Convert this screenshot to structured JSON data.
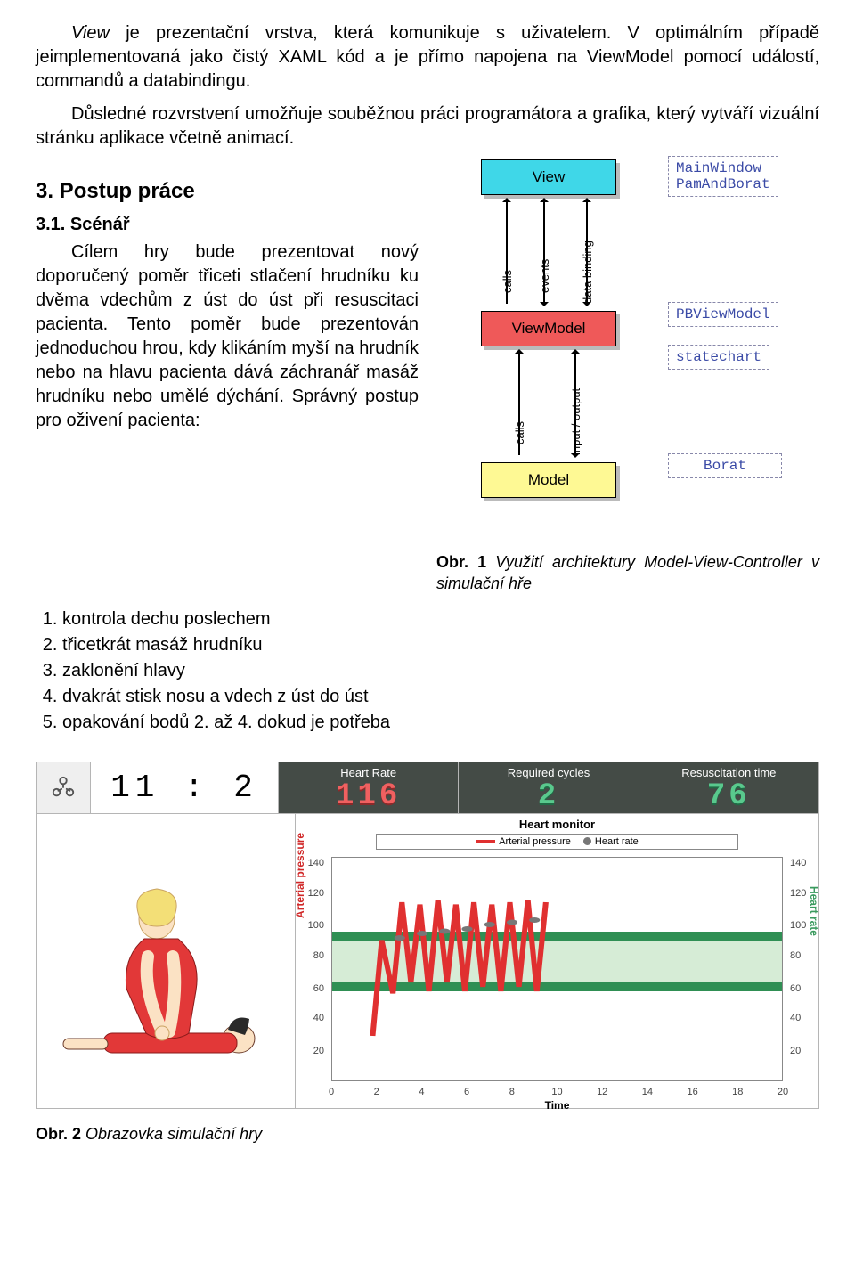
{
  "para1_a": "View",
  "para1_b": " je prezentační vrstva, která komunikuje s uživatelem. V optimálním případě jeimplementovaná jako čistý XAML kód a je přímo napojena na ViewModel pomocí událostí, commandů a databindingu.",
  "para2": "Důsledné rozvrstvení umožňuje souběžnou práci programátora a grafika, který vytváří vizuální stránku aplikace včetně animací.",
  "h_postup": "3. Postup práce",
  "h_scenar": "3.1. Scénář",
  "scenar_p1": "Cílem hry bude prezentovat nový doporučený poměr třiceti stlačení hrudníku ku dvěma vdechům z úst do úst při resuscitaci pacienta. Tento poměr bude prezentován jednoduchou hrou, kdy klikáním myší na hrudník nebo na hlavu pacienta dává záchranář masáž hrudníku nebo umělé dýchání. Správný postup pro oživení pacienta:",
  "steps": [
    "kontrola dechu poslechem",
    "třicetkrát masáž hrudníku",
    "zaklonění hlavy",
    "dvakrát stisk nosu a vdech z úst do úst",
    "opakování bodů 2. až 4. dokud je potřeba"
  ],
  "mvc": {
    "view": "View",
    "vm": "ViewModel",
    "model": "Model",
    "ann_mw": "MainWindow\nPamAndBorat",
    "ann_pbvm": "PBViewModel",
    "ann_sc": "statechart",
    "ann_borat": "Borat",
    "lbl_calls": "calls",
    "lbl_events": "events",
    "lbl_databind": "data binding",
    "lbl_io": "input / output"
  },
  "fig1_b": "Obr. 1",
  "fig1_txt": " Využití architektury Model-View-Controller v simulační hře",
  "sim": {
    "ratio": "11 : 2",
    "metrics": [
      {
        "label": "Heart Rate",
        "value": "116",
        "cls": "red"
      },
      {
        "label": "Required cycles",
        "value": "2",
        "cls": "green"
      },
      {
        "label": "Resuscitation time",
        "value": "76",
        "cls": "green"
      }
    ],
    "chart_title": "Heart monitor",
    "legend_ap": "Arterial pressure",
    "legend_hr": "Heart rate",
    "ax_l": "Arterial pressure",
    "ax_r": "Heart rate",
    "ax_x": "Time"
  },
  "fig2_b": "Obr. 2",
  "fig2_txt": " Obrazovka simulační hry",
  "chart_data": {
    "type": "line",
    "title": "Heart monitor",
    "xlabel": "Time",
    "y_left_label": "Arterial pressure",
    "y_right_label": "Heart rate",
    "x_ticks": [
      0,
      2,
      4,
      6,
      8,
      10,
      12,
      14,
      16,
      18,
      20
    ],
    "y_ticks": [
      20,
      40,
      60,
      80,
      100,
      120,
      140
    ],
    "xlim": [
      0,
      20
    ],
    "ylim": [
      0,
      150
    ],
    "bands": [
      {
        "axis": "y",
        "from": 60,
        "to": 100,
        "color": "light-green"
      },
      {
        "axis": "y",
        "from": 60,
        "to": 66,
        "color": "dark-green"
      },
      {
        "axis": "y",
        "from": 94,
        "to": 100,
        "color": "dark-green"
      }
    ],
    "series": [
      {
        "name": "Arterial pressure",
        "color": "#e03030",
        "x": [
          1.8,
          2.2,
          2.7,
          3.1,
          3.5,
          3.9,
          4.3,
          4.7,
          5.1,
          5.5,
          5.9,
          6.3,
          6.7,
          7.1,
          7.5,
          7.9,
          8.3,
          8.7,
          9.1,
          9.5
        ],
        "y": [
          30,
          95,
          58,
          120,
          66,
          118,
          60,
          122,
          65,
          118,
          60,
          120,
          63,
          119,
          60,
          120,
          62,
          121,
          60,
          120
        ]
      },
      {
        "name": "Heart rate",
        "color": "#777",
        "x": [
          3.0,
          4.0,
          5.0,
          6.0,
          7.0,
          8.0,
          9.0
        ],
        "y": [
          96,
          98,
          100,
          102,
          104,
          106,
          108
        ]
      }
    ]
  }
}
